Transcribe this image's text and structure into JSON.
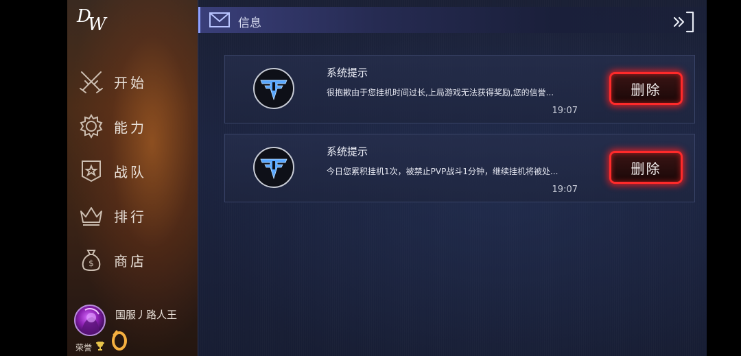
{
  "sidebar": {
    "items": [
      {
        "label": "开始",
        "icon": "crossed-swords-icon"
      },
      {
        "label": "能力",
        "icon": "gear-icon"
      },
      {
        "label": "战队",
        "icon": "shield-star-icon"
      },
      {
        "label": "排行",
        "icon": "crown-icon"
      },
      {
        "label": "商店",
        "icon": "money-bag-icon"
      }
    ],
    "profile": {
      "username": "国服丿路人王",
      "honor_label": "荣誉"
    }
  },
  "header": {
    "title": "信息",
    "icon": "mail-icon",
    "exit_icon": "exit-icon"
  },
  "messages": [
    {
      "title": "系统提示",
      "body": "很抱歉由于您挂机时间过长,上局游戏无法获得奖励,您的信誉...",
      "time": "19:07",
      "delete_label": "删除"
    },
    {
      "title": "系统提示",
      "body": "今日您累积挂机1次，被禁止PVP战斗1分钟，继续挂机将被处...",
      "time": "19:07",
      "delete_label": "删除"
    }
  ],
  "colors": {
    "accent_red": "#ff2a2a",
    "emblem_blue": "#5aa8ff"
  }
}
